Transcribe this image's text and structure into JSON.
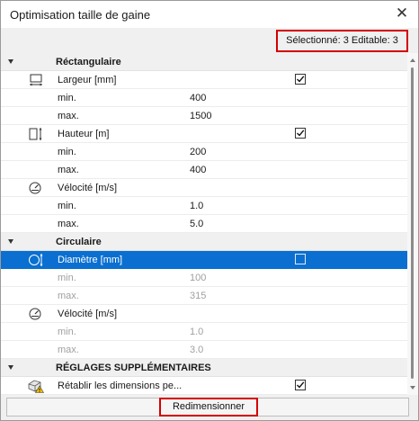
{
  "window": {
    "title": "Optimisation taille de gaine",
    "close_glyph": "✕"
  },
  "info": {
    "status": "Sélectionné: 3 Editable: 3"
  },
  "groups": {
    "rect": {
      "label": "Réctangulaire"
    },
    "circ": {
      "label": "Circulaire"
    },
    "extra": {
      "label": "RÉGLAGES SUPPLÉMENTAIRES"
    }
  },
  "params": {
    "largeur": {
      "label": "Largeur [mm]",
      "icon": "width-icon",
      "checked": true,
      "min_label": "min.",
      "min": "400",
      "max_label": "max.",
      "max": "1500"
    },
    "hauteur": {
      "label": "Hauteur [m]",
      "icon": "height-icon",
      "checked": true,
      "min_label": "min.",
      "min": "200",
      "max_label": "max.",
      "max": "400"
    },
    "velocite_rect": {
      "label": "Vélocité [m/s]",
      "icon": "velocity-gauge-icon",
      "min_label": "min.",
      "min": "1.0",
      "max_label": "max.",
      "max": "5.0"
    },
    "diametre": {
      "label": "Diamètre [mm]",
      "icon": "diameter-icon",
      "checked": false,
      "min_label": "min.",
      "min": "100",
      "max_label": "max.",
      "max": "315"
    },
    "velocite_circ": {
      "label": "Vélocité [m/s]",
      "icon": "velocity-gauge-icon",
      "min_label": "min.",
      "min": "1.0",
      "max_label": "max.",
      "max": "3.0"
    },
    "retablir": {
      "label": "Rétablir les dimensions pe...",
      "icon": "warning-duct-icon",
      "checked": true
    }
  },
  "footer": {
    "button_label": "Redimensionner"
  },
  "colors": {
    "selection": "#0a6fd0",
    "highlight": "#d40000",
    "group_bg": "#f0f0f0"
  }
}
